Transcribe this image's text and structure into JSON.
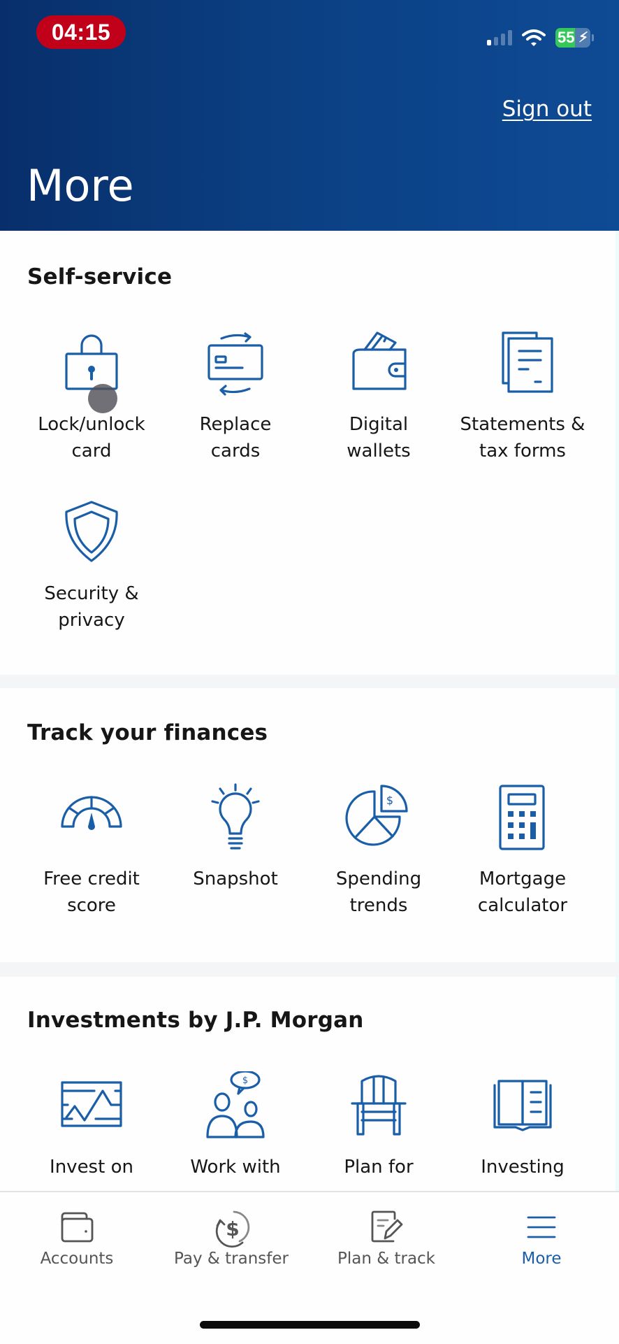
{
  "status_bar": {
    "time": "04:15",
    "battery_percent": "55",
    "battery_level": 0.55,
    "signal_bars_active": 1,
    "signal_bars_total": 4,
    "charging": true
  },
  "header": {
    "title": "More",
    "sign_out_label": "Sign out"
  },
  "sections": [
    {
      "title": "Self-service",
      "items": [
        {
          "label_line1": "Lock/unlock",
          "label_line2": "card",
          "icon": "lock-icon"
        },
        {
          "label_line1": "Replace",
          "label_line2": "cards",
          "icon": "replace-card-icon"
        },
        {
          "label_line1": "Digital",
          "label_line2": "wallets",
          "icon": "wallet-icon"
        },
        {
          "label_line1": "Statements &",
          "label_line2": "tax forms",
          "icon": "documents-icon"
        },
        {
          "label_line1": "Security &",
          "label_line2": "privacy",
          "icon": "shield-icon"
        }
      ]
    },
    {
      "title": "Track your finances",
      "items": [
        {
          "label_line1": "Free credit",
          "label_line2": "score",
          "icon": "gauge-icon"
        },
        {
          "label_line1": "Snapshot",
          "label_line2": "",
          "icon": "lightbulb-icon"
        },
        {
          "label_line1": "Spending",
          "label_line2": "trends",
          "icon": "pie-chart-icon"
        },
        {
          "label_line1": "Mortgage",
          "label_line2": "calculator",
          "icon": "calculator-icon"
        }
      ]
    },
    {
      "title": "Investments by J.P. Morgan",
      "items": [
        {
          "label_line1": "Invest on",
          "label_line2": "",
          "icon": "stock-chart-icon"
        },
        {
          "label_line1": "Work with",
          "label_line2": "",
          "icon": "advisor-icon"
        },
        {
          "label_line1": "Plan for",
          "label_line2": "",
          "icon": "chair-icon"
        },
        {
          "label_line1": "Investing",
          "label_line2": "",
          "icon": "book-icon"
        }
      ]
    }
  ],
  "bottom_nav": {
    "items": [
      {
        "label": "Accounts",
        "icon": "wallet-icon",
        "active": false
      },
      {
        "label": "Pay & transfer",
        "icon": "dollar-cycle-icon",
        "active": false
      },
      {
        "label": "Plan & track",
        "icon": "note-pencil-icon",
        "active": false
      },
      {
        "label": "More",
        "icon": "menu-icon",
        "active": true
      }
    ]
  },
  "colors": {
    "header_gradient_start": "#082f6b",
    "header_gradient_end": "#0e4b95",
    "accent": "#1a5ea8",
    "time_pill": "#c1001a",
    "battery_fill": "#35c759"
  }
}
